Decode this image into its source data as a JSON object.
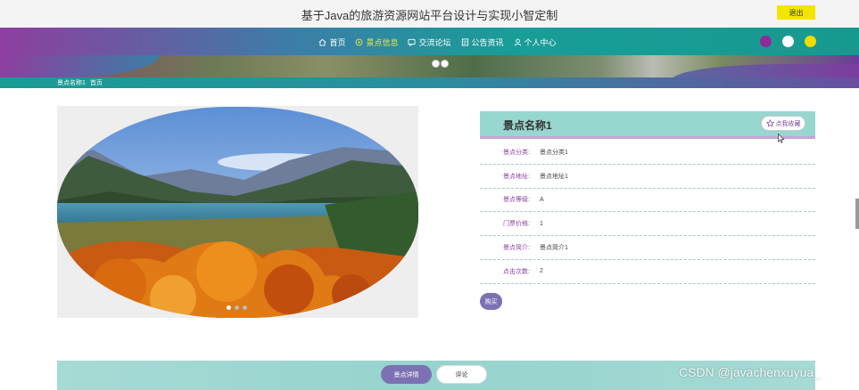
{
  "header": {
    "site_title": "基于Java的旅游资源网站平台设计与实现小智定制",
    "logout_label": "退出"
  },
  "nav": {
    "items": [
      {
        "label": "首页",
        "icon": "home-icon"
      },
      {
        "label": "景点信息",
        "icon": "circle-icon",
        "active": true
      },
      {
        "label": "交流论坛",
        "icon": "forum-icon"
      },
      {
        "label": "公告资讯",
        "icon": "notice-icon"
      },
      {
        "label": "个人中心",
        "icon": "user-icon"
      }
    ],
    "theme_colors": [
      "#8e2a9a",
      "#ffffff",
      "#f2dc00"
    ]
  },
  "breadcrumb": {
    "items": [
      "景点名称1",
      "首页"
    ]
  },
  "detail": {
    "title": "景点名称1",
    "favorite_label": "点我收藏",
    "fields": [
      {
        "label": "景点分类:",
        "value": "景点分类1"
      },
      {
        "label": "景点地址:",
        "value": "景点地址1"
      },
      {
        "label": "景点等级:",
        "value": "A"
      },
      {
        "label": "门票价格:",
        "value": "1"
      },
      {
        "label": "景点简介:",
        "value": "景点简介1"
      },
      {
        "label": "点击次数:",
        "value": "2"
      }
    ],
    "buy_label": "购买"
  },
  "tabs": {
    "details_label": "景点详情",
    "comments_label": "评论"
  },
  "watermark": "CSDN @javachenxuyua_",
  "colors": {
    "accent_teal": "#199d98",
    "accent_purple": "#7c71b3",
    "label_purple": "#8a3e9e",
    "logout_yellow": "#f2e600"
  }
}
